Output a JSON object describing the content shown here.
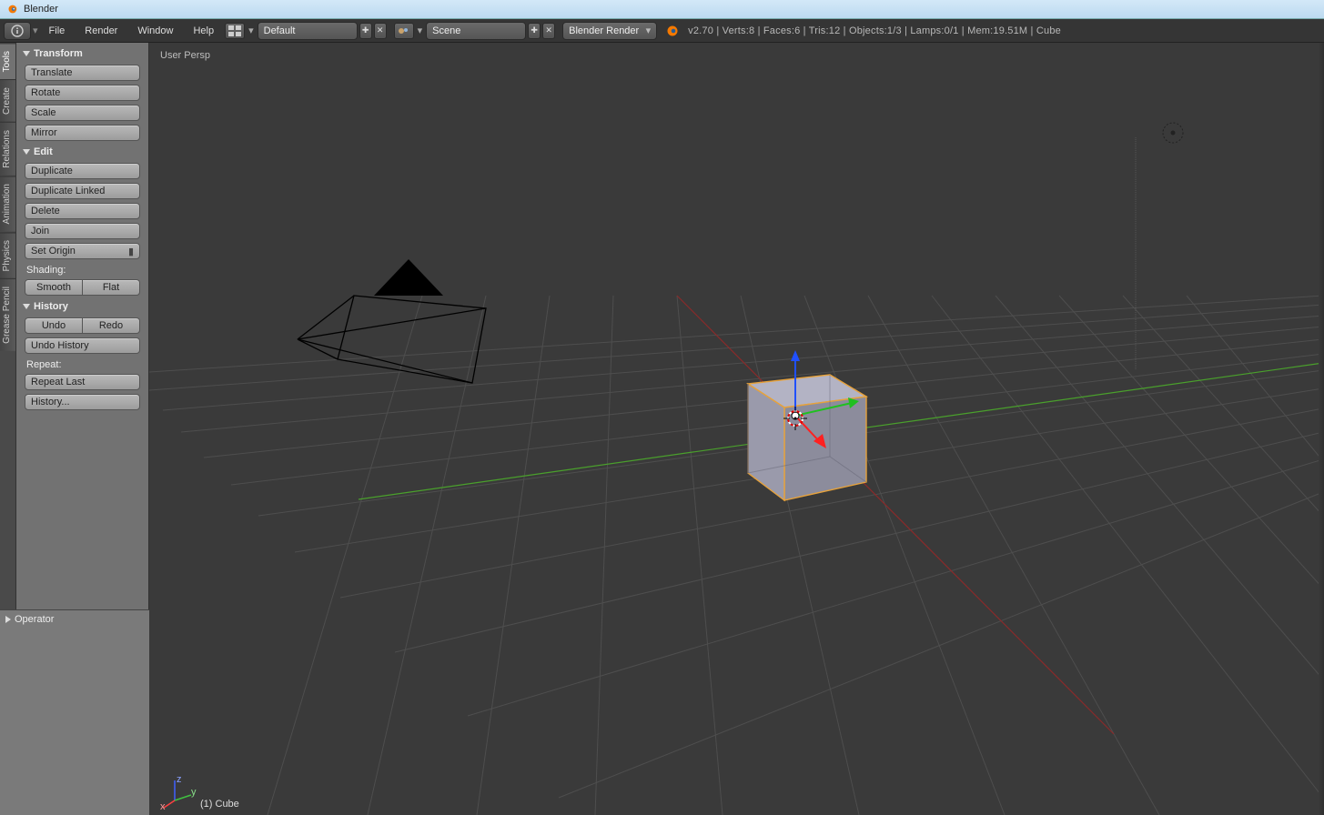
{
  "window": {
    "title": "Blender"
  },
  "menubar": {
    "menus": {
      "file": "File",
      "render": "Render",
      "window": "Window",
      "help": "Help"
    },
    "layout_field": "Default",
    "scene_field": "Scene",
    "engine_field": "Blender Render",
    "version": "v2.70",
    "stats": "Verts:8 | Faces:6 | Tris:12 | Objects:1/3 | Lamps:0/1 | Mem:19.51M | Cube"
  },
  "sidetabs": [
    "Tools",
    "Create",
    "Relations",
    "Animation",
    "Physics",
    "Grease Pencil"
  ],
  "toolpanel": {
    "transform": {
      "title": "Transform",
      "translate": "Translate",
      "rotate": "Rotate",
      "scale": "Scale",
      "mirror": "Mirror"
    },
    "edit": {
      "title": "Edit",
      "duplicate": "Duplicate",
      "duplicate_linked": "Duplicate Linked",
      "delete": "Delete",
      "join": "Join",
      "set_origin": "Set Origin",
      "shading_label": "Shading:",
      "smooth": "Smooth",
      "flat": "Flat"
    },
    "history": {
      "title": "History",
      "undo": "Undo",
      "redo": "Redo",
      "undo_history": "Undo History",
      "repeat_label": "Repeat:",
      "repeat_last": "Repeat Last",
      "history_btn": "History..."
    }
  },
  "operator_panel": {
    "title": "Operator"
  },
  "viewport": {
    "persp_label": "User Persp",
    "object_label": "(1) Cube"
  }
}
